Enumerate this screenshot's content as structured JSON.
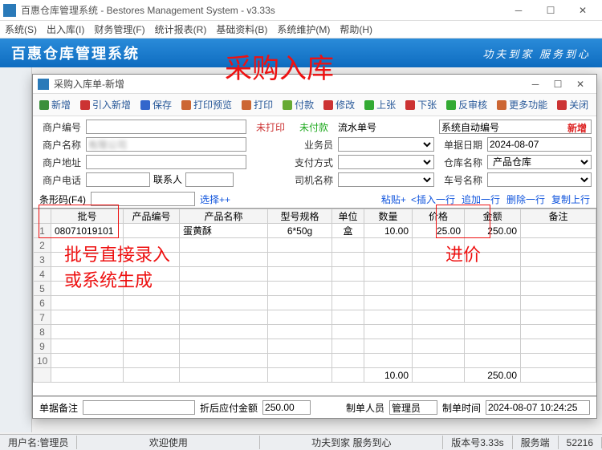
{
  "app": {
    "title": "百惠仓库管理系统 - Bestores Management System - v3.33s",
    "banner_left": "百惠仓库管理系统",
    "banner_right": "功夫到家 服务到心"
  },
  "menus": [
    "系统(S)",
    "出入库(I)",
    "财务管理(F)",
    "统计报表(R)",
    "基础资料(B)",
    "系统维护(M)",
    "帮助(H)"
  ],
  "dialog": {
    "title": "采购入库单-新增",
    "toolbar": {
      "add": "新增",
      "import": "引入新增",
      "save": "保存",
      "preview": "打印预览",
      "print": "打印",
      "pay": "付款",
      "edit": "修改",
      "up": "上张",
      "down": "下张",
      "anti": "反审核",
      "more": "更多功能",
      "close": "关闭"
    },
    "form": {
      "supplier_no_lbl": "商户编号",
      "supplier_no": "",
      "not_printed": "未打印",
      "not_paid": "未付款",
      "serial_lbl": "流水单号",
      "serial": "系统自动编号",
      "status": "新增",
      "supplier_name_lbl": "商户名称",
      "supplier_name": "有限公司",
      "salesman_lbl": "业务员",
      "salesman": "",
      "date_lbl": "单据日期",
      "date": "2024-08-07",
      "addr_lbl": "商户地址",
      "addr": "",
      "pay_lbl": "支付方式",
      "pay": "",
      "wh_lbl": "仓库名称",
      "wh": "产品仓库",
      "tel_lbl": "商户电话",
      "tel": "",
      "contact_lbl": "联系人",
      "contact": "",
      "driver_lbl": "司机名称",
      "driver": "",
      "car_lbl": "车号名称",
      "car": ""
    },
    "barcode": {
      "label": "条形码(F4)",
      "select": "选择++",
      "paste": "粘贴+",
      "links": [
        "<插入一行",
        "追加一行",
        "删除一行",
        "复制上行"
      ]
    },
    "grid": {
      "cols": [
        "批号",
        "产品编号",
        "产品名称",
        "型号规格",
        "单位",
        "数量",
        "价格",
        "金额",
        "备注"
      ],
      "rows": [
        {
          "n": 1,
          "batch": "08071019101",
          "code": "",
          "name": "蛋黄酥",
          "spec": "6*50g",
          "unit": "盒",
          "qty": "10.00",
          "price": "25.00",
          "amt": "250.00",
          "note": ""
        },
        {
          "n": 2
        },
        {
          "n": 3
        },
        {
          "n": 4
        },
        {
          "n": 5
        },
        {
          "n": 6
        },
        {
          "n": 7
        },
        {
          "n": 8
        },
        {
          "n": 9
        },
        {
          "n": 10
        }
      ],
      "totals": {
        "qty": "10.00",
        "amt": "250.00"
      }
    },
    "footer": {
      "note_lbl": "单据备注",
      "note": "",
      "discount_lbl": "折后应付金额",
      "discount": "250.00",
      "maker_lbl": "制单人员",
      "maker": "管理员",
      "mtime_lbl": "制单时间",
      "mtime": "2024-08-07 10:24:25"
    }
  },
  "status": {
    "user_lbl": "用户名:",
    "user": "管理员",
    "welcome": "欢迎使用",
    "slogan": "功夫到家 服务到心",
    "ver": "版本号3.33s",
    "srv_lbl": "服务端",
    "srv": "52216"
  },
  "annotations": {
    "title": "采购入库",
    "batch": "批号直接录入\n或系统生成",
    "price": "进价"
  }
}
